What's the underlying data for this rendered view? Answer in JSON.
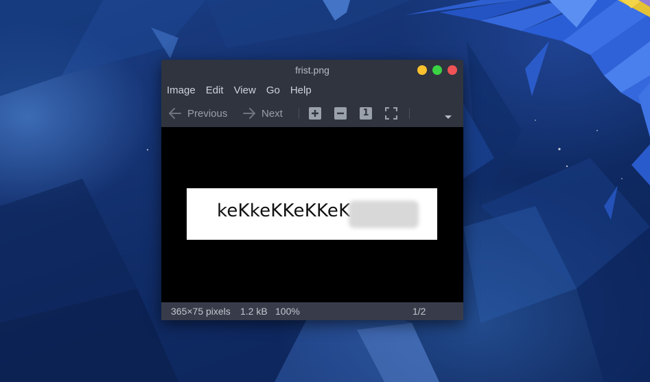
{
  "window": {
    "title": "frist.png"
  },
  "menu": [
    "Image",
    "Edit",
    "View",
    "Go",
    "Help"
  ],
  "toolbar": {
    "previous_label": "Previous",
    "next_label": "Next",
    "zoom_in_icon": "plus",
    "zoom_out_icon": "minus",
    "normal_size_label": "1"
  },
  "image": {
    "text": "keKkeKKeKKeK"
  },
  "status": {
    "dimensions": "365×75 pixels",
    "file_size": "1.2 kB",
    "zoom": "100%",
    "page": "1/2"
  },
  "colors": {
    "minimize": "#fdc22e",
    "maximize": "#3bd244",
    "close": "#f05355"
  }
}
